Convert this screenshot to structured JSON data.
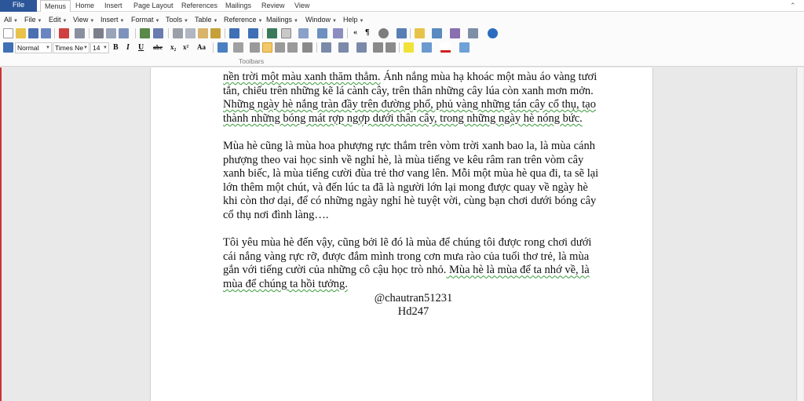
{
  "ribbon": {
    "file_tab": "File",
    "tabs": [
      "Menus",
      "Home",
      "Insert",
      "Page Layout",
      "References",
      "Mailings",
      "Review",
      "View"
    ]
  },
  "menubar": {
    "items": [
      "All",
      "File",
      "Edit",
      "View",
      "Insert",
      "Format",
      "Tools",
      "Table",
      "Reference",
      "Mailings",
      "Window",
      "Help"
    ]
  },
  "format_bar": {
    "style": "Normal",
    "font": "Times Ne",
    "size": "14",
    "bold_label": "B",
    "italic_label": "I",
    "underline_label": "U",
    "strike_label": "abc",
    "sub_label": "x₂",
    "sup_label": "x²",
    "case_label": "Aa"
  },
  "toolbars_label": "Toolbars",
  "document": {
    "para1_line1": "nền trời một màu xanh thăm thẳm.",
    "para1_rest": " Ánh nắng mùa hạ khoác một màu áo vàng tươi tắn, chiếu trên những kẽ lá cành cây, trên thân những cây lúa còn xanh mơn mởn.",
    "para1_wavy": " Những ngày hè nắng tràn đầy trên đường phố, phủ vàng những tán cây cổ thụ, tạo thành những bóng mát rợp ngợp dưới thân cây, trong những ngày hè nóng bức.",
    "para2": "Mùa hè cũng là mùa hoa phượng rực thắm trên vòm trời xanh bao la, là mùa cánh phượng theo vai học sinh về nghỉ hè, là mùa tiếng ve kêu râm ran trên vòm cây xanh biếc, là mùa tiếng cười đùa trẻ thơ vang lên. Mỗi một mùa hè qua đi, ta sẽ lại lớn thêm một chút, và đến lúc ta đã là người lớn lại mong được quay về ngày hè khi còn thơ dại, để có những ngày nghỉ hè tuyệt vời, cùng bạn chơi dưới bóng cây cổ thụ nơi đình làng….",
    "para3_plain": "Tôi yêu mùa hè đến vậy, cũng bởi lẽ đó là mùa để chúng tôi được rong chơi dưới cái nắng vàng rực rỡ, được đắm mình trong cơn mưa rào của tuổi thơ trẻ, là mùa gắn với tiếng cười của những cô cậu học trò nhỏ.",
    "para3_wavy": " Mùa hè là mùa để ta nhớ về, là mùa để chúng ta hồi tưởng.",
    "author": "@chautran51231",
    "tag": "Hd247"
  }
}
